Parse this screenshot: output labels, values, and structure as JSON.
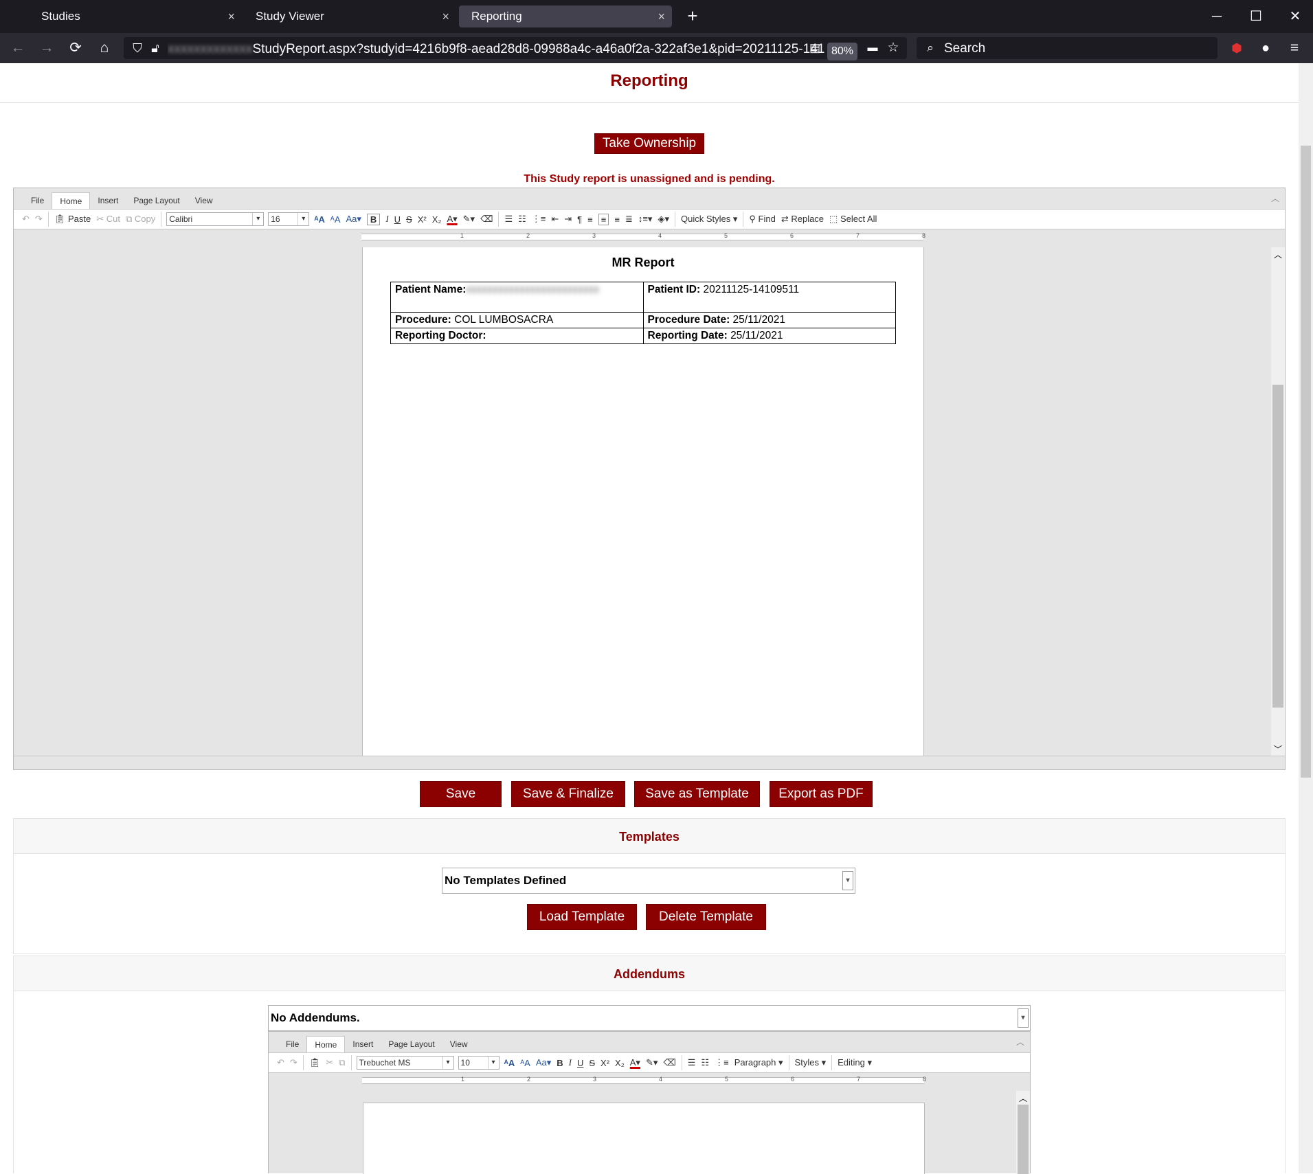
{
  "browser": {
    "tabs": [
      {
        "label": "Studies",
        "close": "×"
      },
      {
        "label": "Study Viewer",
        "close": "×"
      },
      {
        "label": "Reporting",
        "close": "×"
      }
    ],
    "new_tab": "+",
    "window_controls": {
      "minimize": "─",
      "maximize": "☐",
      "close": "✕"
    },
    "url_redacted": "xxxxxxxxxxxxx",
    "url": "StudyReport.aspx?studyid=4216b9f8-aead28d8-09988a4c-a46a0f2a-322af3e1&pid=20211125-141",
    "zoom": "80%",
    "search_placeholder": "Search"
  },
  "page": {
    "title": "Reporting",
    "take_ownership": "Take Ownership",
    "pending_message": "This Study report is unassigned and is pending."
  },
  "editor": {
    "ribbon_tabs": [
      "File",
      "Home",
      "Insert",
      "Page Layout",
      "View"
    ],
    "active_tab": "Home",
    "paste": "Paste",
    "cut": "Cut",
    "copy": "Copy",
    "font": "Calibri",
    "size": "16",
    "quick_styles": "Quick Styles",
    "find": "Find",
    "replace": "Replace",
    "select_all": "Select All",
    "ruler_numbers": [
      "1",
      "2",
      "3",
      "4",
      "5",
      "6",
      "7",
      "8"
    ]
  },
  "report": {
    "heading": "MR Report",
    "patient_name_label": "Patient Name:",
    "patient_name_value": "xxxxxxxxxxxxxxxxxxxxxxxxx",
    "patient_id_label": "Patient ID:",
    "patient_id_value": "20211125-14109511",
    "procedure_label": "Procedure:",
    "procedure_value": "COL LUMBOSACRA",
    "procedure_date_label": "Procedure Date:",
    "procedure_date_value": "25/11/2021",
    "reporting_doctor_label": "Reporting Doctor:",
    "reporting_date_label": "Reporting Date:",
    "reporting_date_value": "25/11/2021"
  },
  "actions": {
    "save": "Save",
    "save_finalize": "Save & Finalize",
    "save_template": "Save as Template",
    "export_pdf": "Export as PDF"
  },
  "templates": {
    "heading": "Templates",
    "selected": "No Templates Defined",
    "load": "Load Template",
    "delete": "Delete Template"
  },
  "addendums": {
    "heading": "Addendums",
    "selected": "No Addendums.",
    "font": "Trebuchet MS",
    "size": "10",
    "paragraph": "Paragraph",
    "styles": "Styles",
    "editing": "Editing"
  }
}
